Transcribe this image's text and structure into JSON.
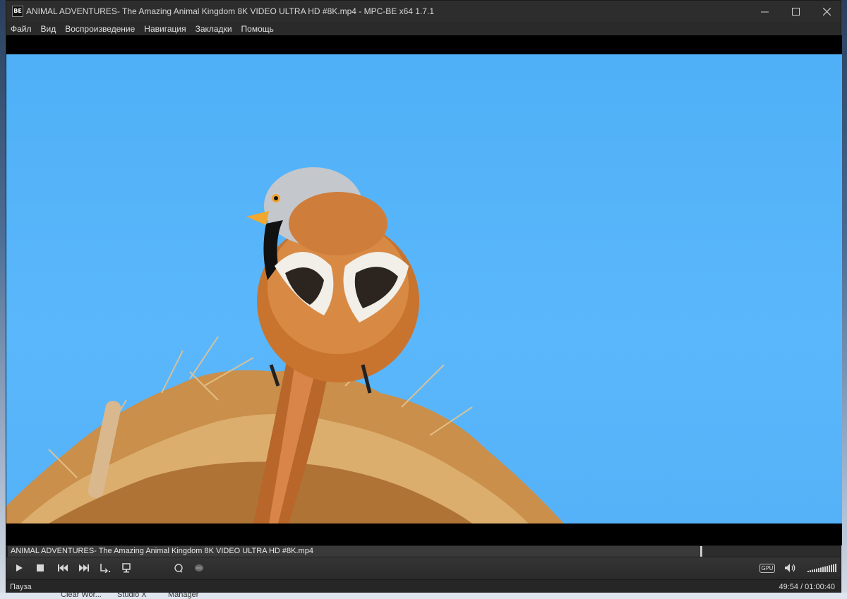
{
  "window": {
    "title": "ANIMAL ADVENTURES- The Amazing Animal Kingdom 8K VIDEO ULTRA HD #8K.mp4 - MPC-BE x64 1.7.1",
    "app_icon_text": "BE",
    "minimize_icon": "minimize-icon",
    "maximize_icon": "maximize-icon",
    "close_icon": "close-icon"
  },
  "menu": {
    "items": [
      {
        "label": "Файл"
      },
      {
        "label": "Вид"
      },
      {
        "label": "Воспроизведение"
      },
      {
        "label": "Навигация"
      },
      {
        "label": "Закладки"
      },
      {
        "label": "Помощь"
      }
    ]
  },
  "seekbar": {
    "filename": "ANIMAL ADVENTURES- The Amazing Animal Kingdom 8K VIDEO ULTRA HD #8K.mp4",
    "progress": 0.831
  },
  "controls": {
    "play_icon": "play-icon",
    "stop_icon": "stop-icon",
    "prev_icon": "previous-icon",
    "next_icon": "next-icon",
    "frame_step_icon": "frame-step-icon",
    "open_icon": "eject-icon",
    "loop_icon": "loop-icon",
    "subtitle_icon": "subtitle-icon",
    "gpu_label": "GPU",
    "volume_icon": "speaker-icon",
    "volume_level": 1.0
  },
  "status": {
    "state": "Пауза",
    "time": "49:54 / 01:00:40"
  },
  "taskbar": {
    "items": [
      "Clear Wor...",
      "Studio X",
      "Manager"
    ]
  }
}
